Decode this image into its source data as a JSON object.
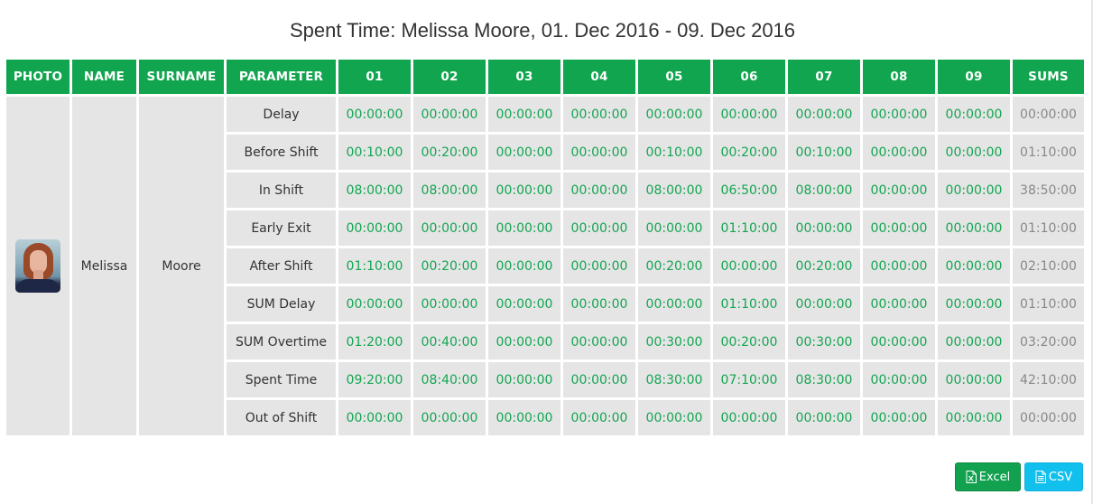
{
  "title": "Spent Time: Melissa Moore, 01. Dec 2016 - 09. Dec 2016",
  "colors": {
    "header_bg": "#10a54e",
    "cell_bg": "#e5e5e5",
    "value_text": "#14a552",
    "sum_text": "#888888",
    "excel_button": "#12a24f",
    "csv_button": "#12c0ee"
  },
  "table": {
    "headers": {
      "photo": "PHOTO",
      "name": "NAME",
      "surname": "SURNAME",
      "parameter": "PARAMETER",
      "days": [
        "01",
        "02",
        "03",
        "04",
        "05",
        "06",
        "07",
        "08",
        "09"
      ],
      "sums": "SUMS"
    },
    "person": {
      "photo_icon": "user-photo",
      "name": "Melissa",
      "surname": "Moore"
    },
    "rows": [
      {
        "parameter": "Delay",
        "values": [
          "00:00:00",
          "00:00:00",
          "00:00:00",
          "00:00:00",
          "00:00:00",
          "00:00:00",
          "00:00:00",
          "00:00:00",
          "00:00:00"
        ],
        "sum": "00:00:00"
      },
      {
        "parameter": "Before Shift",
        "values": [
          "00:10:00",
          "00:20:00",
          "00:00:00",
          "00:00:00",
          "00:10:00",
          "00:20:00",
          "00:10:00",
          "00:00:00",
          "00:00:00"
        ],
        "sum": "01:10:00"
      },
      {
        "parameter": "In Shift",
        "values": [
          "08:00:00",
          "08:00:00",
          "00:00:00",
          "00:00:00",
          "08:00:00",
          "06:50:00",
          "08:00:00",
          "00:00:00",
          "00:00:00"
        ],
        "sum": "38:50:00"
      },
      {
        "parameter": "Early Exit",
        "values": [
          "00:00:00",
          "00:00:00",
          "00:00:00",
          "00:00:00",
          "00:00:00",
          "01:10:00",
          "00:00:00",
          "00:00:00",
          "00:00:00"
        ],
        "sum": "01:10:00"
      },
      {
        "parameter": "After Shift",
        "values": [
          "01:10:00",
          "00:20:00",
          "00:00:00",
          "00:00:00",
          "00:20:00",
          "00:00:00",
          "00:20:00",
          "00:00:00",
          "00:00:00"
        ],
        "sum": "02:10:00"
      },
      {
        "parameter": "SUM Delay",
        "values": [
          "00:00:00",
          "00:00:00",
          "00:00:00",
          "00:00:00",
          "00:00:00",
          "01:10:00",
          "00:00:00",
          "00:00:00",
          "00:00:00"
        ],
        "sum": "01:10:00"
      },
      {
        "parameter": "SUM Overtime",
        "values": [
          "01:20:00",
          "00:40:00",
          "00:00:00",
          "00:00:00",
          "00:30:00",
          "00:20:00",
          "00:30:00",
          "00:00:00",
          "00:00:00"
        ],
        "sum": "03:20:00"
      },
      {
        "parameter": "Spent Time",
        "values": [
          "09:20:00",
          "08:40:00",
          "00:00:00",
          "00:00:00",
          "08:30:00",
          "07:10:00",
          "08:30:00",
          "00:00:00",
          "00:00:00"
        ],
        "sum": "42:10:00"
      },
      {
        "parameter": "Out of Shift",
        "values": [
          "00:00:00",
          "00:00:00",
          "00:00:00",
          "00:00:00",
          "00:00:00",
          "00:00:00",
          "00:00:00",
          "00:00:00",
          "00:00:00"
        ],
        "sum": "00:00:00"
      }
    ]
  },
  "export": {
    "excel_label": "Excel",
    "excel_icon": "file-excel-icon",
    "csv_label": "CSV",
    "csv_icon": "file-text-icon"
  }
}
